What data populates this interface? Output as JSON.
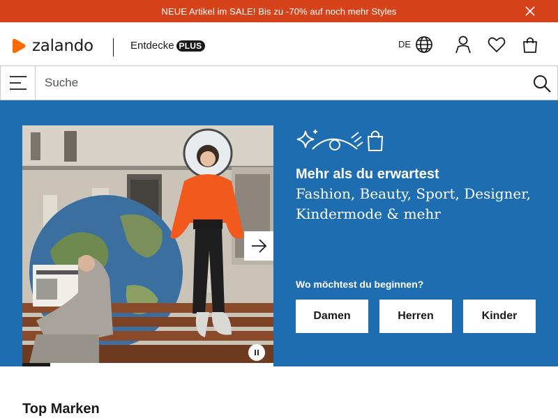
{
  "promo": {
    "text": "NEUE Artikel im SALE! Bis zu -70% auf noch mehr Styles",
    "close_icon": "close-icon"
  },
  "header": {
    "logo_text": "zalando",
    "entdecke_label": "Entdecke",
    "plus_label": "PLUS",
    "language": "DE",
    "icons": [
      "globe-icon",
      "user-icon",
      "heart-icon",
      "shopping-bag-icon"
    ],
    "brand_color": "#ff6900"
  },
  "search": {
    "placeholder": "Suche",
    "menu_icon": "menu-icon",
    "search_icon": "search-icon"
  },
  "hero": {
    "background": "#1e6db1",
    "title": "Mehr als du erwartest",
    "subtitle": "Fashion, Beauty, Sport, Designer, Kindermode & mehr",
    "question": "Wo möchtest du beginnen?",
    "buttons": [
      "Damen",
      "Herren",
      "Kinder"
    ],
    "carousel_progress": 0.11,
    "icons": [
      "sparkle-icon",
      "eye-icon",
      "shopping-bag-icon"
    ]
  },
  "sections": {
    "top_brands_title": "Top Marken"
  }
}
